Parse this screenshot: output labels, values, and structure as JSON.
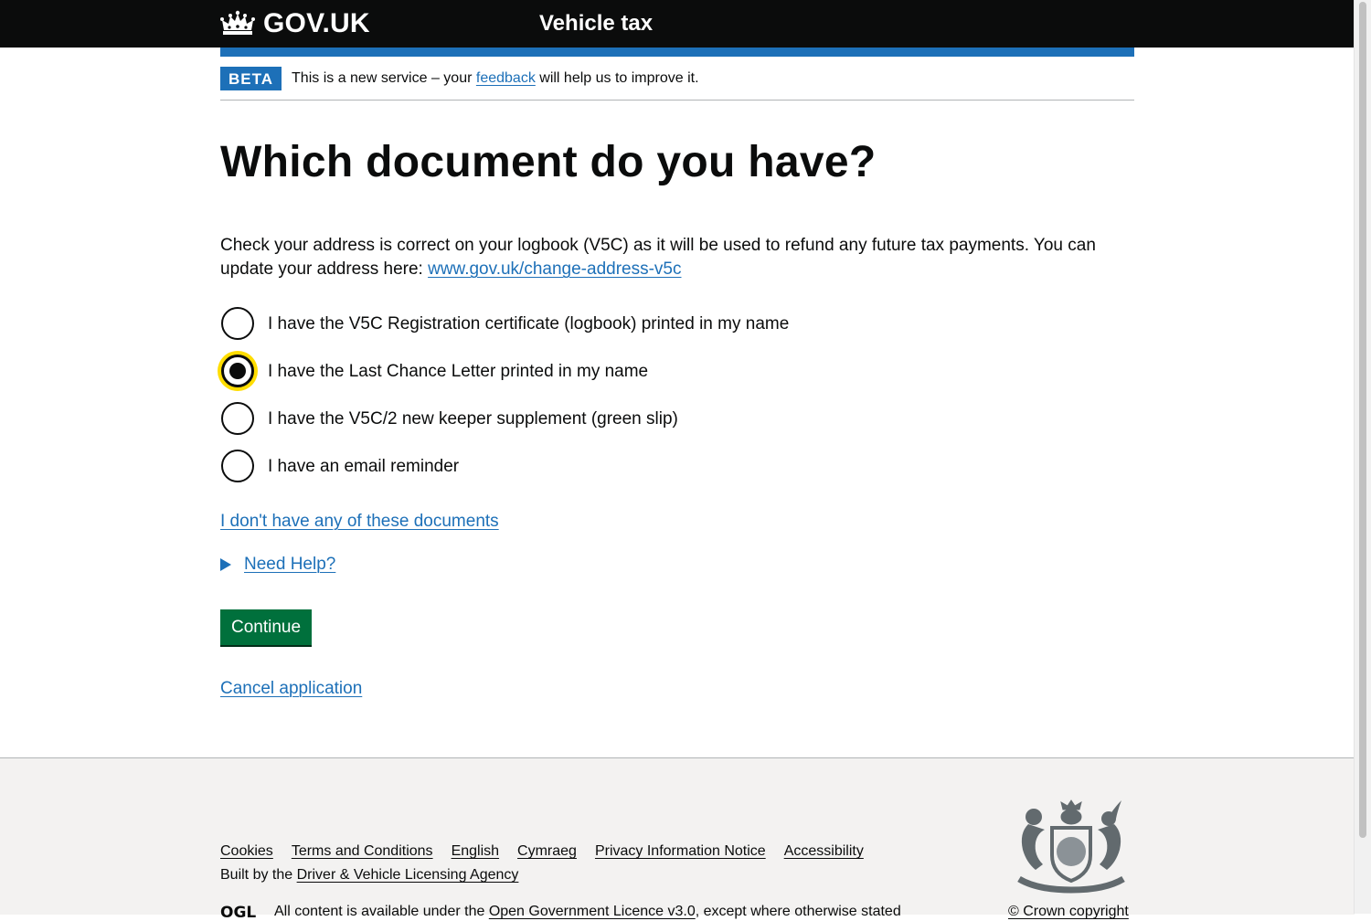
{
  "header": {
    "logo_text": "GOV.UK",
    "service_name": "Vehicle tax",
    "icon": "crown-icon"
  },
  "phase_banner": {
    "tag": "BETA",
    "text_before": "This is a new service – your ",
    "link": "feedback",
    "text_after": " will help us to improve it."
  },
  "main": {
    "title": "Which document do you have?",
    "hint_text": "Check your address is correct on your logbook (V5C) as it will be used to refund any future tax payments. You can update your address here: ",
    "hint_link": "www.gov.uk/change-address-v5c",
    "radios": [
      {
        "label": "I have the V5C Registration certificate (logbook) printed in my name",
        "checked": false
      },
      {
        "label": "I have the Last Chance Letter printed in my name",
        "checked": true
      },
      {
        "label": "I have the V5C/2 new keeper supplement (green slip)",
        "checked": false
      },
      {
        "label": "I have an email reminder",
        "checked": false
      }
    ],
    "no_documents_link": "I don't have any of these documents",
    "help_summary": "Need Help?",
    "continue_button": "Continue",
    "cancel_link": "Cancel application"
  },
  "footer": {
    "links": [
      "Cookies",
      "Terms and Conditions",
      "English",
      "Cymraeg",
      "Privacy Information Notice",
      "Accessibility"
    ],
    "built_by_prefix": "Built by the ",
    "built_by_link": "Driver & Vehicle Licensing Agency",
    "licence_text_before": "All content is available under the ",
    "licence_link": "Open Government Licence v3.0",
    "licence_text_after": ", except where otherwise stated",
    "copyright": "© Crown copyright",
    "ogl_logo": "OGL"
  },
  "colors": {
    "header_bg": "#0b0c0c",
    "brand_blue": "#1d70b8",
    "button_green": "#00703c",
    "focus_yellow": "#ffdd00",
    "footer_bg": "#f3f2f1"
  }
}
